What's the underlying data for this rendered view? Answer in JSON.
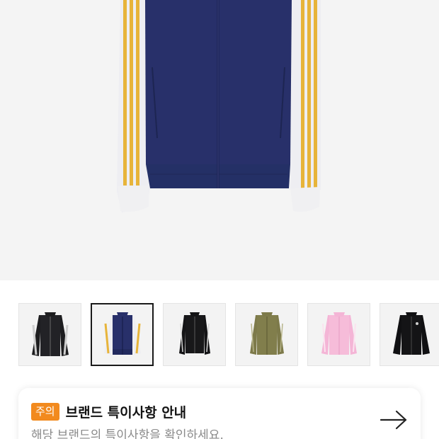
{
  "colors": {
    "hero_bg": "#f4f4f4",
    "jacket_navy": "#28306a",
    "sleeve_white": "#eeeef2",
    "stripe_yellow": "#e7b43a",
    "badge_orange": "#f28a1e"
  },
  "product": {
    "main_image": "navy-track-jacket-yellow-stripes",
    "thumbnails": [
      {
        "name": "black-track-jacket-white-stripes",
        "selected": false
      },
      {
        "name": "navy-track-jacket-yellow-stripes",
        "selected": true
      },
      {
        "name": "black-track-jacket-fitted",
        "selected": false
      },
      {
        "name": "olive-track-jacket",
        "selected": false
      },
      {
        "name": "pink-track-jacket",
        "selected": false
      },
      {
        "name": "black-track-jacket-velour",
        "selected": false
      }
    ]
  },
  "notice": {
    "badge": "주의",
    "title": "브랜드 특이사항 안내",
    "subtitle": "해당 브랜드의 특이사항을 확인하세요.",
    "arrow_icon": "arrow-right-icon"
  }
}
